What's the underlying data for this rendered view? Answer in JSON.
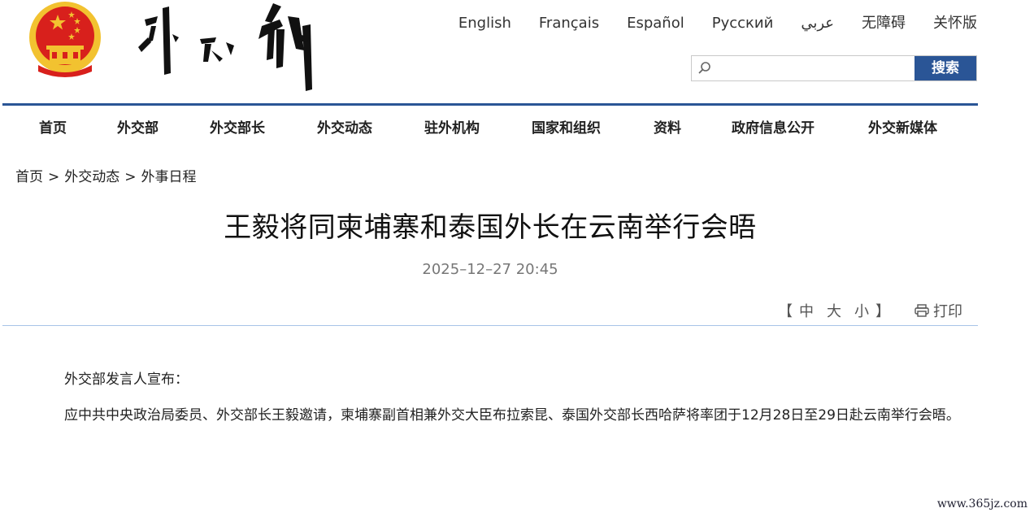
{
  "header": {
    "languages": [
      "English",
      "Français",
      "Español",
      "Русский",
      "عربي",
      "无障碍",
      "关怀版"
    ],
    "search": {
      "placeholder": "",
      "button_label": "搜索"
    }
  },
  "nav": {
    "items": [
      "首页",
      "外交部",
      "外交部长",
      "外交动态",
      "驻外机构",
      "国家和组织",
      "资料",
      "政府信息公开",
      "外交新媒体"
    ]
  },
  "breadcrumb": {
    "items": [
      "首页",
      "外交动态",
      "外事日程"
    ],
    "separator": ">"
  },
  "article": {
    "title": "王毅将同柬埔寨和泰国外长在云南举行会晤",
    "date": "2025–12–27 20:45",
    "font_size": {
      "open_bracket": "【",
      "large": "中",
      "medium": "大",
      "small": "小",
      "close_bracket": "】"
    },
    "print_label": "打印",
    "paragraphs": [
      "外交部发言人宣布：",
      "应中共中央政治局委员、外交部长王毅邀请，柬埔寨副首相兼外交大臣布拉索昆、泰国外交部长西哈萨将率团于12月28日至29日赴云南举行会晤。"
    ]
  },
  "watermark": "www.365jz.com",
  "colors": {
    "brand_blue": "#2a5596",
    "divider_blue": "#a7c4e8",
    "emblem_red": "#d8201c",
    "emblem_gold": "#f2c230"
  }
}
